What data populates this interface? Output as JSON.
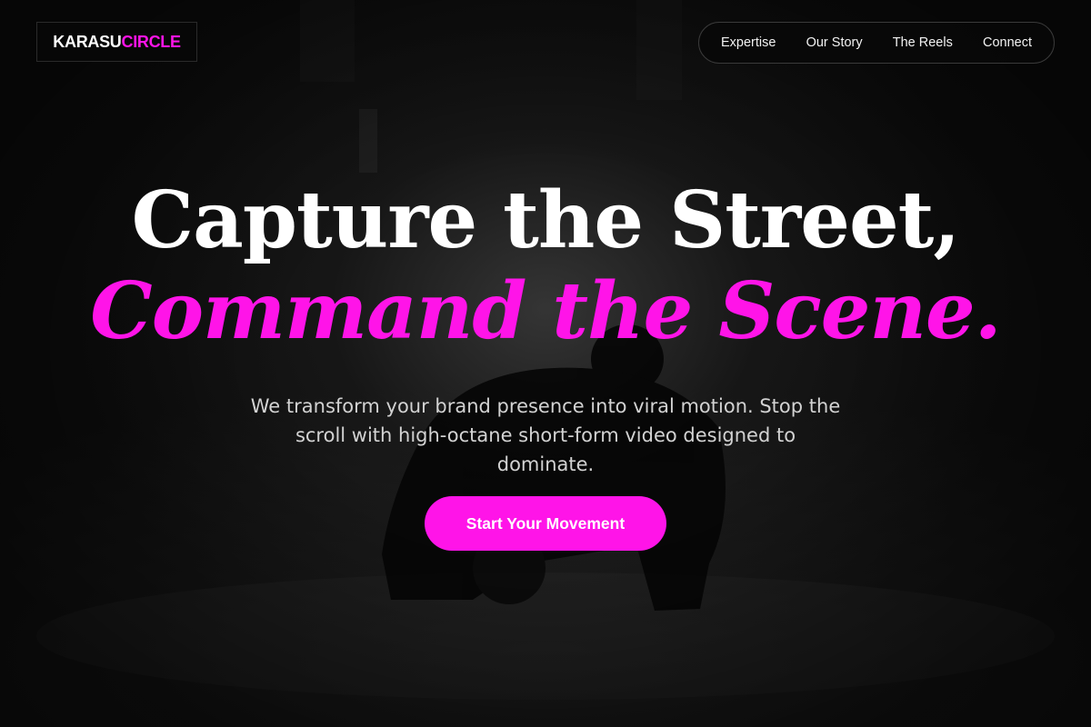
{
  "header": {
    "logo": {
      "part1": "KARASU",
      "part2": "CIRCLE"
    },
    "nav": [
      {
        "label": "Expertise"
      },
      {
        "label": "Our Story"
      },
      {
        "label": "The Reels"
      },
      {
        "label": "Connect"
      }
    ]
  },
  "hero": {
    "headline_line1": "Capture the Street,",
    "headline_line2": "Command the Scene.",
    "subtext": "We transform your brand presence into viral motion. Stop the scroll with high-octane short-form video designed to dominate.",
    "cta_label": "Start Your Movement"
  },
  "colors": {
    "accent": "#ff14e8",
    "background": "#0d0d0d",
    "text": "#ffffff",
    "muted_text": "#d2d2d2"
  }
}
